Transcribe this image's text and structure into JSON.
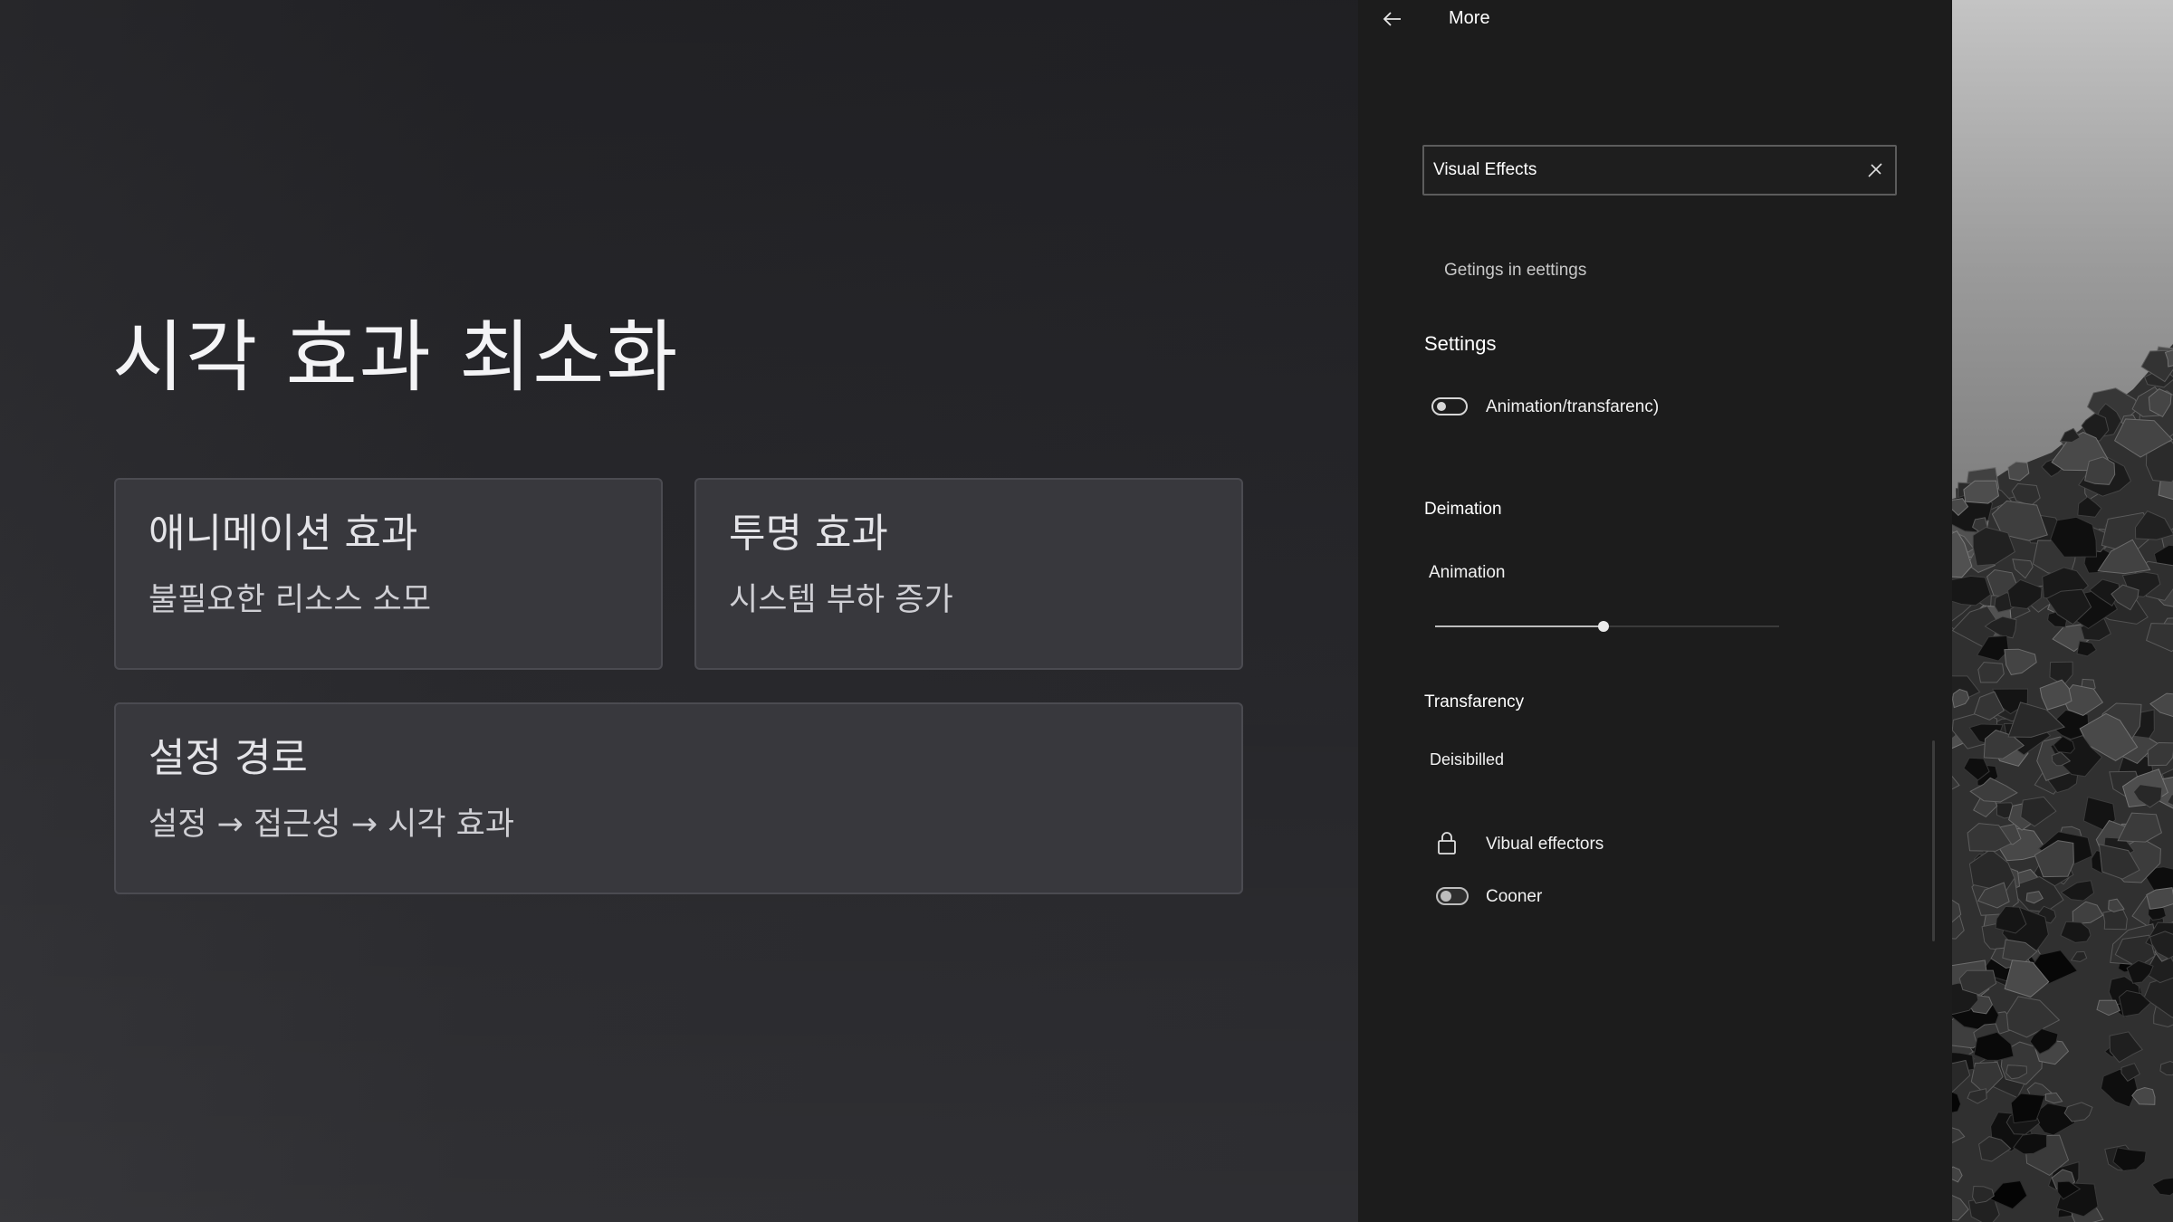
{
  "slide": {
    "title": "시각 효과 최소화",
    "cards": [
      {
        "title": "애니메이션 효과",
        "subtitle": "불필요한 리소스 소모"
      },
      {
        "title": "투명 효과",
        "subtitle": "시스템 부하 증가"
      },
      {
        "title": "설정 경로",
        "subtitle": "설정 → 접근성 → 시각 효과"
      }
    ]
  },
  "panel": {
    "header": {
      "back_icon": "back-arrow-icon",
      "title": "More"
    },
    "search": {
      "value": "Visual Effects",
      "clear_icon": "clear-icon"
    },
    "suggestion": "Getings in eettings",
    "sections": {
      "settings": {
        "heading": "Settings",
        "toggle_label": "Animation/transfarenc)",
        "toggle_on": false
      },
      "deimation": {
        "heading": "Deimation",
        "slider_label": "Animation",
        "slider_value": 0.49
      },
      "transparency": {
        "heading": "Transfarency",
        "status": "Deisibilled",
        "lock_icon": "lock-icon",
        "lock_label": "Vibual effectors",
        "toggle_label": "Cooner",
        "toggle_on": false
      }
    }
  },
  "colors": {
    "slide_bg": "#242428",
    "card_bg": "#38383d",
    "panel_bg": "#1c1c1c",
    "text_primary": "#ffffff"
  }
}
